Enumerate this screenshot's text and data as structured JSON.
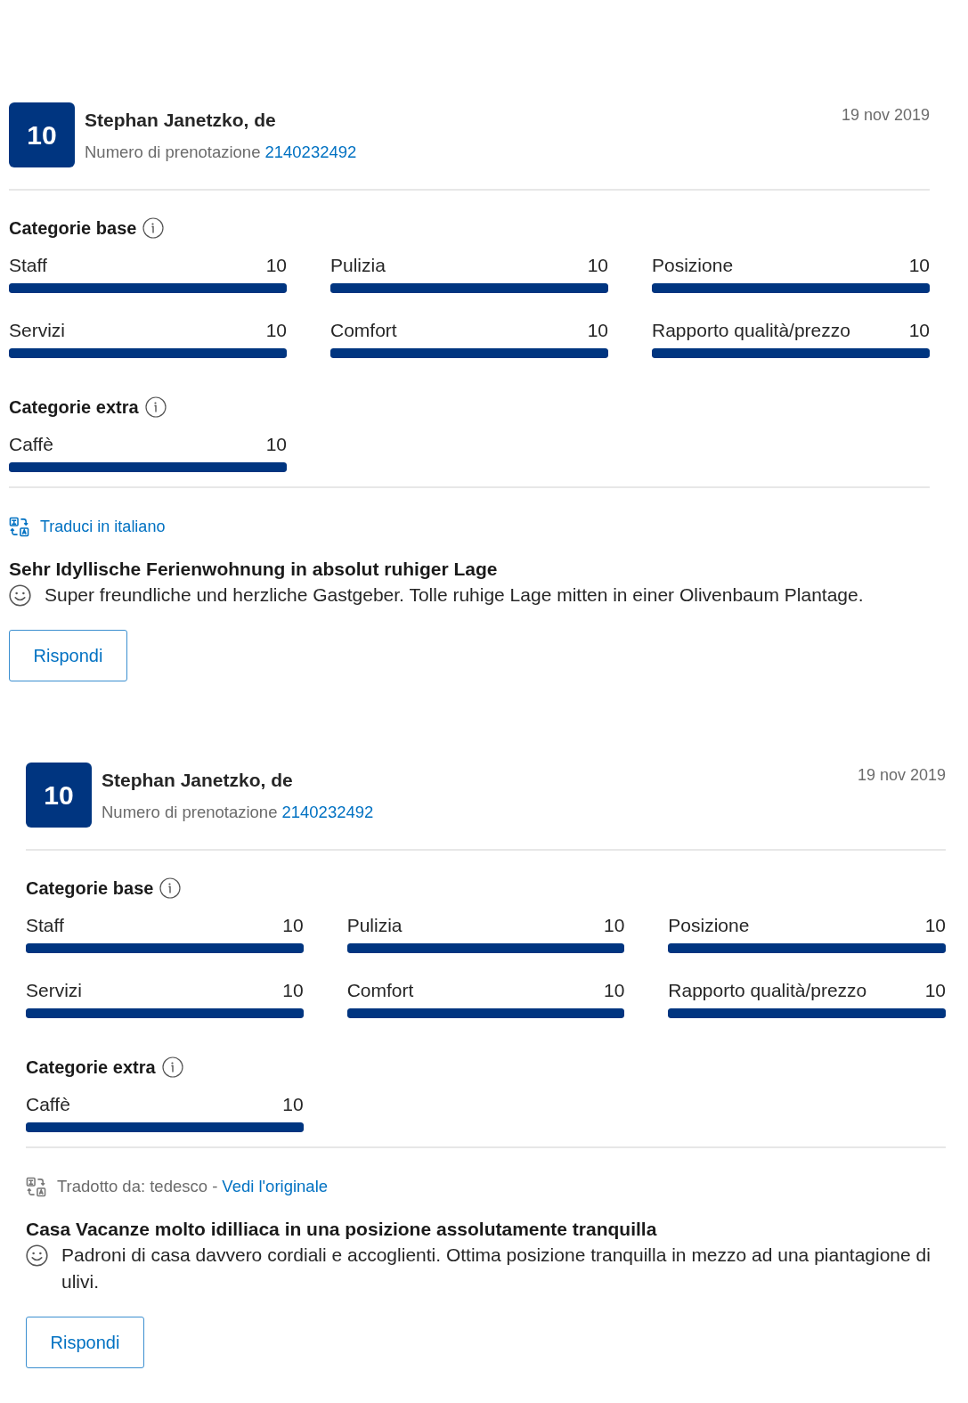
{
  "reviews": [
    {
      "score": "10",
      "reviewer": "Stephan Janetzko, de",
      "booking_label": "Numero di prenotazione",
      "booking_number": "2140232492",
      "date": "19 nov 2019",
      "category_groups": [
        {
          "title": "Categorie base",
          "items": [
            {
              "name": "Staff",
              "score": "10",
              "level": 1
            },
            {
              "name": "Pulizia",
              "score": "10",
              "level": 1
            },
            {
              "name": "Posizione",
              "score": "10",
              "level": 1
            },
            {
              "name": "Servizi",
              "score": "10",
              "level": 1
            },
            {
              "name": "Comfort",
              "score": "10",
              "level": 1
            },
            {
              "name": "Rapporto qualità/prezzo",
              "score": "10",
              "level": 1
            }
          ]
        },
        {
          "title": "Categorie extra",
          "items": [
            {
              "name": "Caffè",
              "score": "10",
              "level": 1
            }
          ]
        }
      ],
      "translation": {
        "kind": "link",
        "label": "Traduci in italiano"
      },
      "title": "Sehr Idyllische Ferienwohnung in absolut ruhiger Lage",
      "text": "Super freundliche und herzliche Gastgeber. Tolle ruhige Lage mitten in einer Olivenbaum Plantage.",
      "reply_button": "Rispondi"
    },
    {
      "score": "10",
      "reviewer": "Stephan Janetzko, de",
      "booking_label": "Numero di prenotazione",
      "booking_number": "2140232492",
      "date": "19 nov 2019",
      "category_groups": [
        {
          "title": "Categorie base",
          "items": [
            {
              "name": "Staff",
              "score": "10",
              "level": 1
            },
            {
              "name": "Pulizia",
              "score": "10",
              "level": 1
            },
            {
              "name": "Posizione",
              "score": "10",
              "level": 1
            },
            {
              "name": "Servizi",
              "score": "10",
              "level": 1
            },
            {
              "name": "Comfort",
              "score": "10",
              "level": 1
            },
            {
              "name": "Rapporto qualità/prezzo",
              "score": "10",
              "level": 1
            }
          ]
        },
        {
          "title": "Categorie extra",
          "items": [
            {
              "name": "Caffè",
              "score": "10",
              "level": 1
            }
          ]
        }
      ],
      "translation": {
        "kind": "notice",
        "label": "Tradotto da: tedesco -",
        "link": "Vedi l'originale"
      },
      "title": "Casa Vacanze molto idilliaca in una posizione assolutamente tranquilla",
      "text": "Padroni di casa davvero cordiali e accoglienti. Ottima posizione tranquilla in mezzo ad una piantagione di ulivi.",
      "reply_button": "Rispondi"
    }
  ]
}
